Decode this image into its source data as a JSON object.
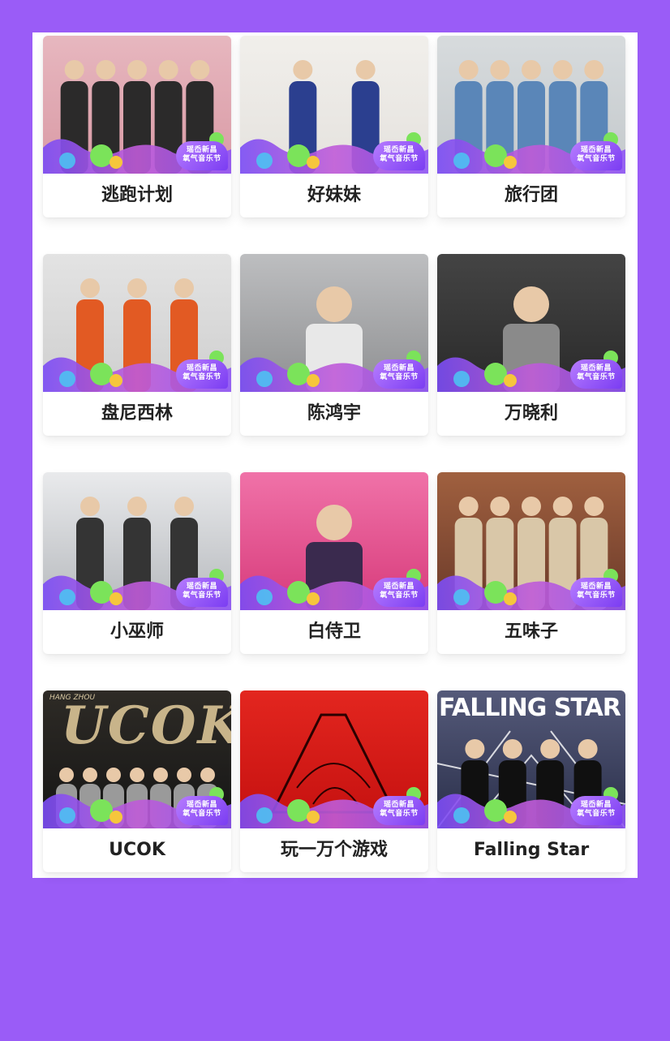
{
  "badge": {
    "line1": "瑶岙新昌",
    "line2": "氧气音乐节"
  },
  "artists": [
    {
      "name": "逃跑计划",
      "photo_bg": [
        "#d99aa5",
        "#e7b7bf"
      ],
      "people": 5,
      "fig": "#2b2a2a"
    },
    {
      "name": "好妹妹",
      "photo_bg": [
        "#e5e2de",
        "#f1efeb"
      ],
      "people": 2,
      "fig": "#2b3f8f"
    },
    {
      "name": "旅行团",
      "photo_bg": [
        "#c4c9cc",
        "#d7dbdd"
      ],
      "people": 5,
      "fig": "#5a86b8"
    },
    {
      "name": "盘尼西林",
      "photo_bg": [
        "#cfcfcf",
        "#e3e3e3"
      ],
      "people": 3,
      "fig": "#e25a23"
    },
    {
      "name": "陈鸿宇",
      "photo_bg": [
        "#8f9092",
        "#bdbec0"
      ],
      "people": 1,
      "fig": "#e8e8e8"
    },
    {
      "name": "万晓利",
      "photo_bg": [
        "#2a2a2a",
        "#444444"
      ],
      "people": 1,
      "fig": "#8a8a8a"
    },
    {
      "name": "小巫师",
      "photo_bg": [
        "#b6b9bd",
        "#e9eaec"
      ],
      "people": 3,
      "fig": "#343434"
    },
    {
      "name": "白侍卫",
      "photo_bg": [
        "#d73b7b",
        "#f072a8"
      ],
      "people": 1,
      "fig": "#3a2a4e"
    },
    {
      "name": "五味子",
      "photo_bg": [
        "#6b3a2a",
        "#a0603f"
      ],
      "people": 5,
      "fig": "#d9c7a8"
    },
    {
      "name": "UCOK",
      "photo_bg": [
        "#151515",
        "#2e2b26"
      ],
      "people": 7,
      "fig": "#9a9a9a",
      "poster_title": "UCOK",
      "poster_sub": "HANG ZHOU"
    },
    {
      "name": "玩一万个游戏",
      "photo_bg": [
        "#c4100f",
        "#e3261f"
      ],
      "people": 0,
      "fig": "#2a0000"
    },
    {
      "name": "Falling Star",
      "photo_bg": [
        "#2a2f4a",
        "#555a7a"
      ],
      "people": 4,
      "fig": "#101010",
      "poster_title": "FALLING STAR"
    }
  ],
  "colors": {
    "background": "#9a5cf7",
    "panel": "#ffffff",
    "name_text": "#222222"
  }
}
